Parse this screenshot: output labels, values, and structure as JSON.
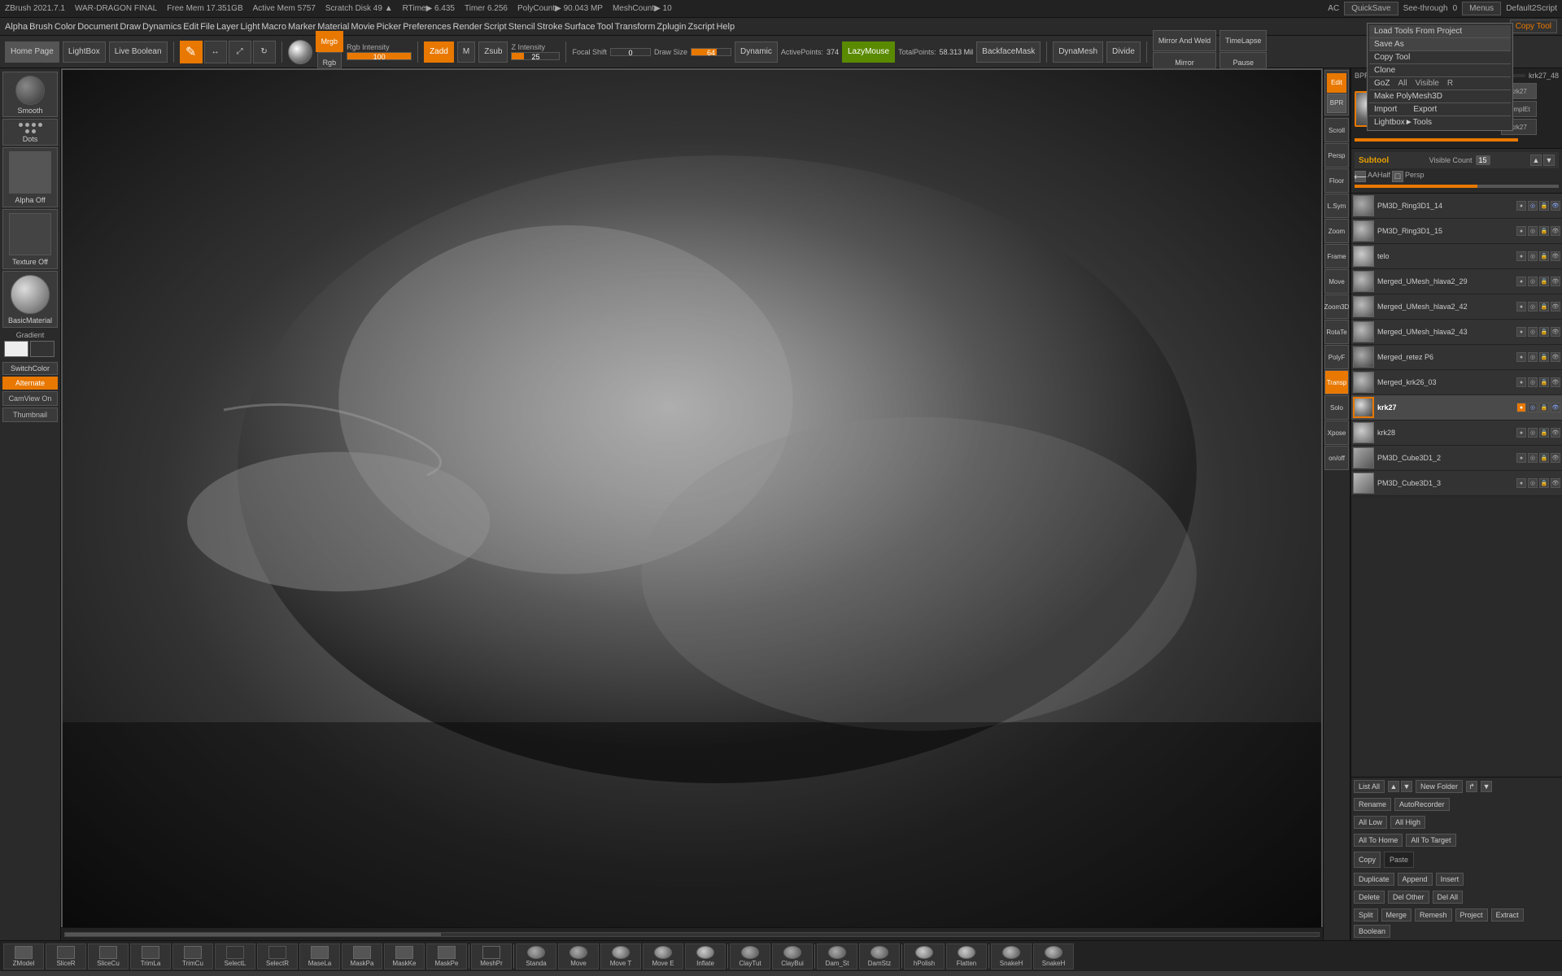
{
  "app": {
    "title": "ZBrush 2021.7.1",
    "file": "WAR-DRAGON FINAL",
    "mem": "Free Mem 17.351GB",
    "active_mem": "Active Mem 5757",
    "scratch_disk": "Scratch Disk 49 ▲",
    "rtime": "RTime▶ 6.435",
    "timer": "Timer 6.256",
    "poly_count": "PolyCount▶ 90.043 MP",
    "mesh_count": "MeshCount▶ 10"
  },
  "top_right": {
    "ac": "AC",
    "quick_save": "QuickSave",
    "see_through_label": "See-through",
    "see_through_value": "0",
    "menus_label": "Menus",
    "default_material": "Default2Script"
  },
  "menu_items": [
    "Alpha",
    "Brush",
    "Color",
    "Document",
    "Draw",
    "Dynamics",
    "Edit",
    "File",
    "Layer",
    "Light",
    "Macro",
    "Marker",
    "Material",
    "Movie",
    "Picker",
    "Preferences",
    "Render",
    "Script",
    "Stencil",
    "Stroke",
    "Surface",
    "Tool",
    "Transform",
    "Zplugin",
    "Zscript",
    "Help"
  ],
  "quick_save_btn": "QuickSave",
  "save_as_btn": "Save As",
  "toolbar": {
    "home_page": "Home Page",
    "lightbox": "LightBox",
    "live_boolean": "Live Boolean",
    "draw": "Draw",
    "move": "Move",
    "scale": "Scale",
    "rotate": "RotaTe",
    "mrgb": "Mrgb",
    "rgb": "Rgb",
    "rgb_intensity_label": "Rgb Intensity",
    "rgb_intensity_value": "100",
    "zadd": "Zadd",
    "m": "M",
    "zsub": "Zsub",
    "z_intensity_label": "Z Intensity",
    "z_intensity_value": "25",
    "focal_shift_label": "Focal Shift",
    "focal_shift_value": "0",
    "draw_size_label": "Draw Size",
    "draw_size_value": "64",
    "dynamic": "Dynamic",
    "active_points_label": "ActivePoints:",
    "active_points_value": "374",
    "lazy_mouse": "LazyMouse",
    "total_points_label": "TotalPoints:",
    "total_points_value": "58.313 Mil",
    "backface_mask": "BackfaceMask",
    "dynamo_mesh": "DynaMesh",
    "divide": "Divide",
    "mirror_and_weld": "Mirror And Weld",
    "mirror": "Mirror",
    "time_lapse": "TimeLapse",
    "pause": "Pause",
    "copy_tool": "Copy Tool"
  },
  "left_panel": {
    "smooth_label": "Smooth",
    "dots_label": "Dots",
    "alpha_off_label": "Alpha Off",
    "texture_off_label": "Texture Off",
    "basic_material_label": "BasicMaterial",
    "gradient_label": "Gradient",
    "switch_color": "SwitchColor",
    "alternate": "Alternate",
    "cam_view_on": "CamView On",
    "thumbnail": "Thumbnail"
  },
  "right_strip": {
    "btns": [
      "Edit",
      "BPR",
      "Scroll",
      "Persp",
      "Floor",
      "L.Sym",
      "Zoom",
      "Frame",
      "Move",
      "Zoom3D",
      "RotaTe",
      "PolyF",
      "Transp",
      "Solo",
      "Xpose",
      "on/off"
    ]
  },
  "subtool_panel": {
    "title": "Subtool",
    "visible_count_label": "Visible Count",
    "visible_count_value": "15",
    "scroll_bar_pct": 60,
    "meshes": [
      {
        "name": "PM3D_Ring3D1_14",
        "selected": false
      },
      {
        "name": "PM3D_Ring3D1_15",
        "selected": false
      },
      {
        "name": "telo",
        "selected": false
      },
      {
        "name": "Merged_UMesh_hlava2_29",
        "selected": false
      },
      {
        "name": "Merged_UMesh_hlava2_42",
        "selected": false
      },
      {
        "name": "Merged_UMesh_hlava2_43",
        "selected": false
      },
      {
        "name": "Merged_retez P6",
        "selected": false
      },
      {
        "name": "Merged_krk26_03",
        "selected": false
      },
      {
        "name": "krk27",
        "selected": true
      },
      {
        "name": "krk28",
        "selected": false
      },
      {
        "name": "PM3D_Cube3D1_2",
        "selected": false
      },
      {
        "name": "PM3D_Cube3D1_3",
        "selected": false
      }
    ],
    "list_btn": "List All",
    "new_folder_btn": "New Folder",
    "rename_btn": "Rename",
    "auto_recorder": "AutoRecorder",
    "all_low_btn": "All Low",
    "all_high_btn": "All High",
    "all_to_home": "All To Home",
    "all_to_target": "All To Target",
    "copy_btn": "Copy",
    "paste_btn": "Paste",
    "duplicate_btn": "Duplicate",
    "append_btn": "Append",
    "insert_btn": "Insert",
    "delete_btn": "Delete",
    "del_other_btn": "Del Other",
    "del_all_btn": "Del All",
    "split_btn": "Split",
    "merge_btn": "Merge",
    "remesh_btn": "Remesh",
    "project_btn": "Project",
    "extract_btn": "Extract",
    "boolean_btn": "Boolean"
  },
  "context_menu": {
    "visible": true,
    "items": [
      "Load Tools From Project",
      "Copy Tool",
      "Clone",
      "GoZ",
      "Make PolyMesh3D",
      "Import",
      "Export",
      "Lightbox►Tools"
    ]
  },
  "bottom_tools": [
    {
      "label": "ZModel",
      "icon": "zm"
    },
    {
      "label": "SliceR",
      "icon": "sr"
    },
    {
      "label": "SliceCu",
      "icon": "sc"
    },
    {
      "label": "TrimLa",
      "icon": "tl"
    },
    {
      "label": "TrimCu",
      "icon": "tc"
    },
    {
      "label": "SelectL",
      "icon": "sl"
    },
    {
      "label": "SelectR",
      "icon": "sr2"
    },
    {
      "label": "MaseLa",
      "icon": "ml"
    },
    {
      "label": "MaskPa",
      "icon": "mp"
    },
    {
      "label": "MaskKe",
      "icon": "mk"
    },
    {
      "label": "MaskPe",
      "icon": "mpe"
    },
    {
      "label": "MeshPr",
      "icon": "mpr"
    },
    {
      "label": "Standa",
      "icon": "std"
    },
    {
      "label": "Move",
      "icon": "mv"
    },
    {
      "label": "Move T",
      "icon": "mvt"
    },
    {
      "label": "Move E",
      "icon": "mve"
    },
    {
      "label": "Inflate",
      "icon": "inf"
    },
    {
      "label": "ClayTut",
      "icon": "ct"
    },
    {
      "label": "ClayBui",
      "icon": "cb"
    },
    {
      "label": "Dam_St",
      "icon": "ds"
    },
    {
      "label": "DamStz",
      "icon": "dsz"
    },
    {
      "label": "hPolish",
      "icon": "hp"
    },
    {
      "label": "Flatten",
      "icon": "fl"
    },
    {
      "label": "SnakeH",
      "icon": "sh"
    },
    {
      "label": "SnakeH",
      "icon": "sh2"
    }
  ],
  "colors": {
    "orange": "#e87800",
    "dark_bg": "#222222",
    "panel_bg": "#2a2a2a",
    "btn_bg": "#3a3a3a",
    "border": "#555555",
    "text": "#cccccc",
    "header_text": "#e8a000"
  }
}
